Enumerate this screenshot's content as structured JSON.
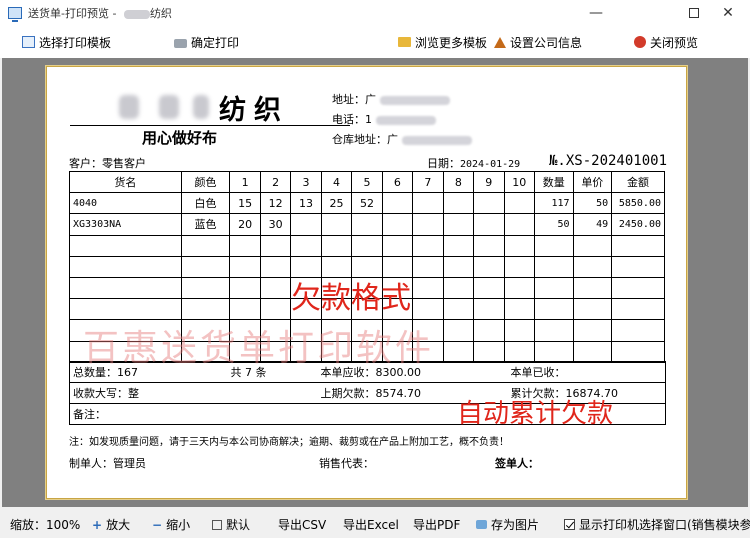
{
  "window": {
    "title": "送货单-打印预览 - ",
    "title_suffix": "纺织"
  },
  "toolbar": {
    "select_template": "选择打印模板",
    "confirm_print": "确定打印",
    "browse_templates": "浏览更多模板",
    "company_settings": "设置公司信息",
    "close_preview": "关闭预览"
  },
  "doc": {
    "company_name": "纺织",
    "slogan": "用心做好布",
    "address_label": "地址：",
    "address_value": "广",
    "phone_label": "电话：",
    "phone_value": "1",
    "warehouse_label": "仓库地址：",
    "warehouse_value": "广",
    "customer_label": "客户：",
    "customer_value": "零售客户",
    "date_label": "日期：",
    "date_value": "2024-01-29",
    "docno": "№.XS-202401001",
    "headers": [
      "货名",
      "颜色",
      "1",
      "2",
      "3",
      "4",
      "5",
      "6",
      "7",
      "8",
      "9",
      "10",
      "数量",
      "单价",
      "金额"
    ],
    "rows": [
      [
        "4040",
        "白色",
        "15",
        "12",
        "13",
        "25",
        "52",
        "",
        "",
        "",
        "",
        "",
        "117",
        "50",
        "5850.00"
      ],
      [
        "XG3303NA",
        "蓝色",
        "20",
        "30",
        "",
        "",
        "",
        "",
        "",
        "",
        "",
        "",
        "50",
        "49",
        "2450.00"
      ],
      [
        "",
        "",
        "",
        "",
        "",
        "",
        "",
        "",
        "",
        "",
        "",
        "",
        "",
        "",
        ""
      ],
      [
        "",
        "",
        "",
        "",
        "",
        "",
        "",
        "",
        "",
        "",
        "",
        "",
        "",
        "",
        ""
      ],
      [
        "",
        "",
        "",
        "",
        "",
        "",
        "",
        "",
        "",
        "",
        "",
        "",
        "",
        "",
        ""
      ],
      [
        "",
        "",
        "",
        "",
        "",
        "",
        "",
        "",
        "",
        "",
        "",
        "",
        "",
        "",
        ""
      ],
      [
        "",
        "",
        "",
        "",
        "",
        "",
        "",
        "",
        "",
        "",
        "",
        "",
        "",
        "",
        ""
      ],
      [
        "",
        "",
        "",
        "",
        "",
        "",
        "",
        "",
        "",
        "",
        "",
        "",
        "",
        "",
        ""
      ]
    ],
    "total_qty": "总数量：167",
    "total_count": "共  7  条",
    "due": "本单应收：8300.00",
    "received": "本单已收：",
    "amount_words": "收款大写：整",
    "prev_debt": "上期欠款：8574.70",
    "cum_debt": "累计欠款：16874.70",
    "remark": "备注：",
    "note": "注：如发现质量问题，请于三天内与本公司协商解决；逾期、裁剪或在产品上附加工艺，概不负责！",
    "maker": "制单人：管理员",
    "sales_rep": "销售代表：",
    "signer": "签单人：",
    "overlay_title": "欠款格式",
    "overlay_auto": "自动累计欠款",
    "watermark": "百惠送货单打印软件"
  },
  "statusbar": {
    "zoom": "缩放：100%",
    "zoom_in": "放大",
    "zoom_out": "缩小",
    "default": "默认",
    "export_csv": "导出CSV",
    "export_excel": "导出Excel",
    "export_pdf": "导出PDF",
    "save_image": "存为图片",
    "show_printer_dialog": "显示打印机选择窗口(销售模块参数"
  },
  "colors": {
    "accent_red": "#e0261b",
    "paper_border": "#c8a544",
    "preview_bg": "#808080"
  }
}
